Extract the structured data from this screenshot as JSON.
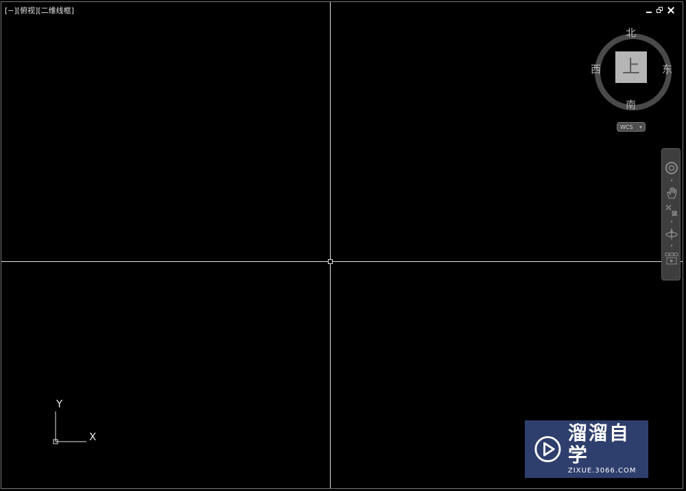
{
  "viewport": {
    "label": "[−][俯视][二维线框]"
  },
  "viewcube": {
    "north": "北",
    "south": "南",
    "west": "西",
    "east": "东",
    "top_face": "上",
    "wcs_label": "WCS"
  },
  "navbar": {
    "tools": [
      "steering-wheel-icon",
      "pan-hand-icon",
      "zoom-extents-icon",
      "orbit-icon",
      "showmotion-icon"
    ]
  },
  "ucs": {
    "x_label": "X",
    "y_label": "Y"
  },
  "watermark": {
    "brand": "溜溜自学",
    "url": "ZIXUE.3066.COM"
  },
  "colors": {
    "background": "#000000",
    "crosshair": "#e6e6e6",
    "watermark_bg": "#2f3f6d"
  }
}
